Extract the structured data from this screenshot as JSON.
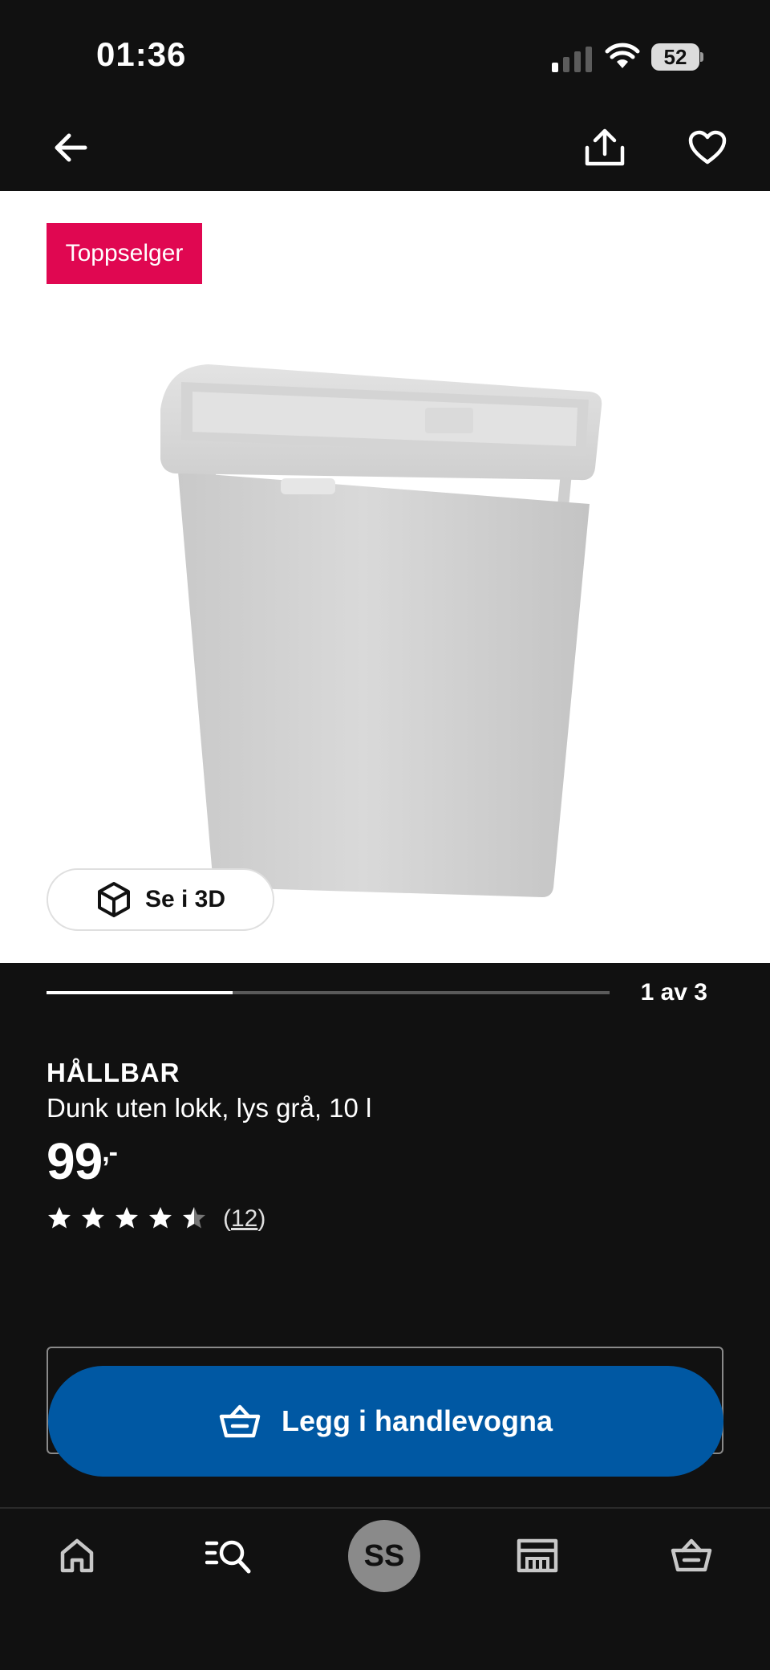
{
  "status_bar": {
    "time": "01:36",
    "battery": "52"
  },
  "top_nav": {
    "back_icon": "arrow-left-icon",
    "share_icon": "share-icon",
    "favorite_icon": "heart-icon"
  },
  "hero": {
    "badge": "Toppselger",
    "view3d_label": "Se i 3D"
  },
  "gallery": {
    "counter": "1 av 3",
    "progress": 0.33
  },
  "product": {
    "brand": "HÅLLBAR",
    "description": "Dunk uten lokk, lys grå, 10 l",
    "price": "99",
    "price_suffix": ",-",
    "rating": 4.5,
    "reviews_open": "(",
    "reviews_count": "12",
    "reviews_close": ")"
  },
  "cart": {
    "label": "Legg i handlevogna"
  },
  "bottom_nav": {
    "items": [
      "home-icon",
      "search-icon",
      "avatar",
      "store-icon",
      "cart-icon"
    ],
    "avatar_initials": "SS"
  },
  "colors": {
    "badge": "#e00751",
    "primary": "#0058a3",
    "background": "#111111"
  }
}
